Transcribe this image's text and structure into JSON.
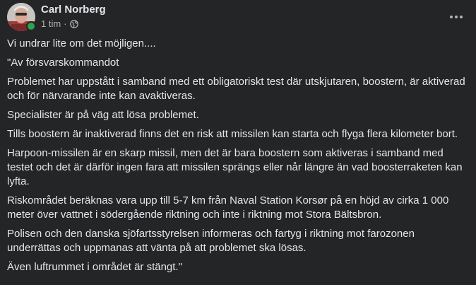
{
  "post": {
    "author": "Carl Norberg",
    "time": "1 tim",
    "separator": "·",
    "privacy_icon": "globe-icon",
    "more_icon": "more-options-icon",
    "paragraphs": [
      "Vi undrar lite om det möjligen....",
      "\"Av försvarskommandot",
      "Problemet har uppstått i samband med ett obligatoriskt test där utskjutaren, boostern, är aktiverad och för närvarande inte kan avaktiveras.",
      "Specialister är på väg att lösa problemet.",
      "Tills boostern är inaktiverad finns det en risk att missilen kan starta och flyga flera kilometer bort.",
      "Harpoon-missilen är en skarp missil, men det är bara boostern som aktiveras i samband med testet och det är därför ingen fara att missilen sprängs eller når längre än vad boosterraketen kan lyfta.",
      "Riskområdet beräknas vara upp till 5-7 km från Naval Station Korsør på en höjd av cirka 1 000 meter över vattnet i södergående riktning och inte i riktning mot Stora Bältsbron.",
      "Polisen och den danska sjöfartsstyrelsen informeras och fartyg i riktning mot farozonen underrättas och uppmanas att vänta på att problemet ska lösas.",
      "Även luftrummet i området är stängt.\""
    ]
  },
  "colors": {
    "background": "#242526",
    "text_primary": "#e4e6eb",
    "text_secondary": "#b0b3b8",
    "online": "#31a24c"
  }
}
